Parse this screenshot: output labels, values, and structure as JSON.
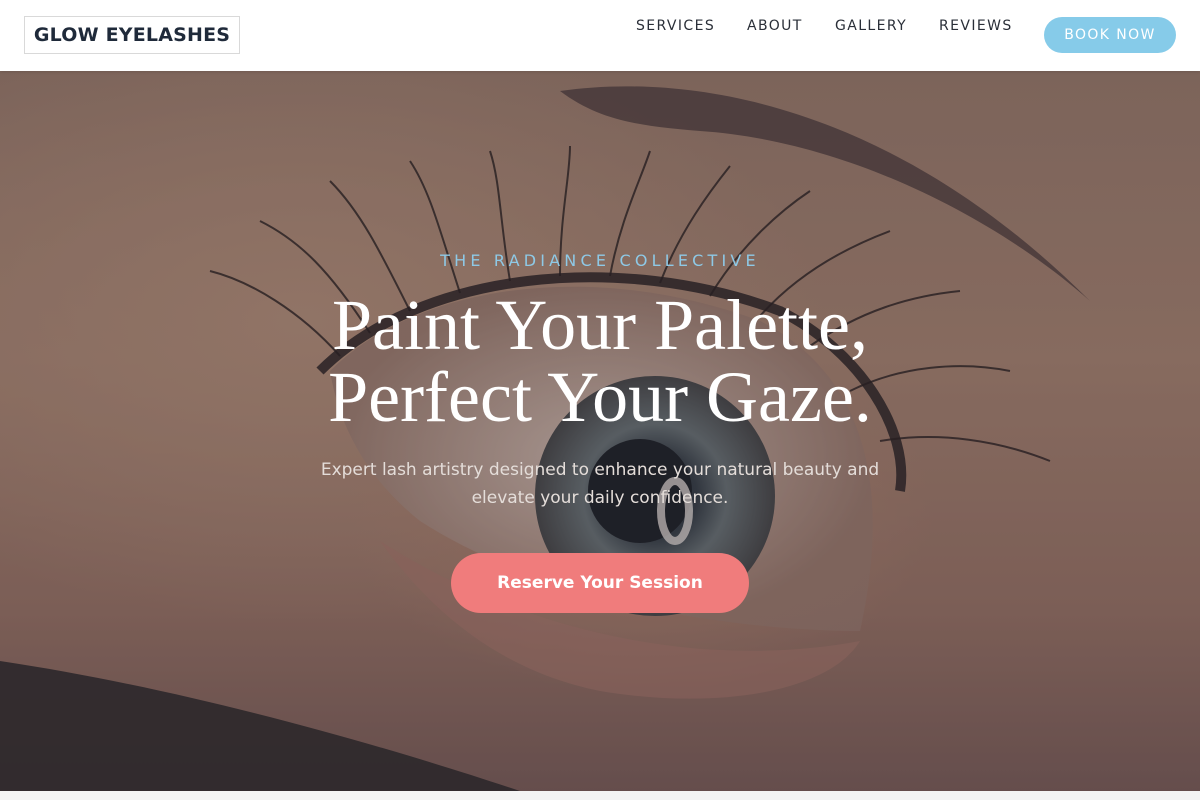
{
  "header": {
    "logo_text": "GLOW EYELASHES",
    "nav": [
      "SERVICES",
      "ABOUT",
      "GALLERY",
      "REVIEWS"
    ],
    "book_label": "BOOK NOW"
  },
  "hero": {
    "eyebrow": "THE RADIANCE COLLECTIVE",
    "headline_line1": "Paint Your Palette,",
    "headline_line2": "Perfect Your Gaze.",
    "subtext": "Expert lash artistry designed to enhance your natural beauty and elevate your daily confidence.",
    "cta_label": "Reserve Your Session",
    "image": "eye-closeup-photo"
  },
  "colors": {
    "accent_blue": "#86cbe9",
    "cta_coral": "#f07c7c",
    "logo_text": "#1f2a3a"
  }
}
